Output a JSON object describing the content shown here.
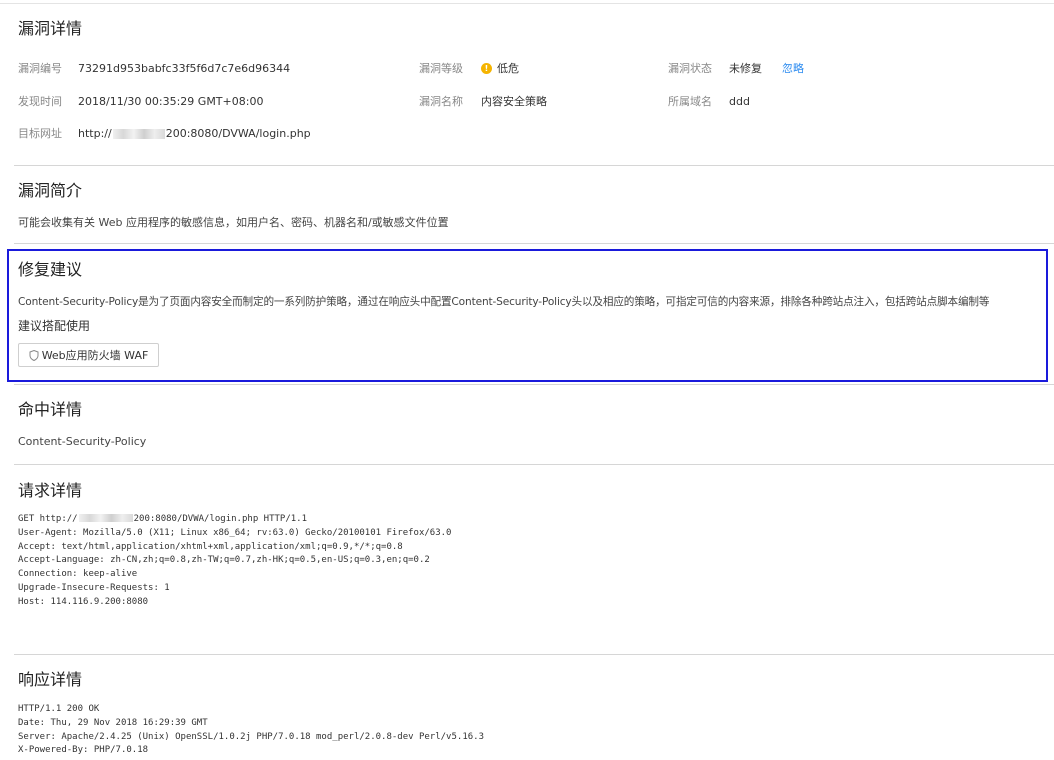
{
  "vuln_details": {
    "title": "漏洞详情",
    "id_label": "漏洞编号",
    "id_value": "73291d953babfc33f5f6d7c7e6d96344",
    "level_label": "漏洞等级",
    "level_value": "低危",
    "level_color": "#f5b400",
    "status_label": "漏洞状态",
    "status_value": "未修复",
    "ignore_link": "忽略",
    "found_time_label": "发现时间",
    "found_time_value": "2018/11/30 00:35:29 GMT+08:00",
    "name_label": "漏洞名称",
    "name_value": "内容安全策略",
    "domain_label": "所属域名",
    "domain_value": "ddd",
    "url_label": "目标网址",
    "url_prefix": "http://",
    "url_suffix": "200:8080/DVWA/login.php"
  },
  "summary": {
    "title": "漏洞简介",
    "text": "可能会收集有关 Web 应用程序的敏感信息，如用户名、密码、机器名和/或敏感文件位置"
  },
  "fix": {
    "title": "修复建议",
    "text": "Content-Security-Policy是为了页面内容安全而制定的一系列防护策略，通过在响应头中配置Content-Security-Policy头以及相应的策略，可指定可信的内容来源，排除各种跨站点注入，包括跨站点脚本编制等",
    "recommend_label": "建议搭配使用",
    "waf_button": "Web应用防火墙 WAF",
    "highlight_color": "#1a1adb"
  },
  "hit": {
    "title": "命中详情",
    "text": "Content-Security-Policy"
  },
  "request": {
    "title": "请求详情",
    "line1_prefix": "GET http://",
    "line1_suffix": "200:8080/DVWA/login.php HTTP/1.1",
    "lines": [
      "User-Agent: Mozilla/5.0 (X11; Linux x86_64; rv:63.0) Gecko/20100101 Firefox/63.0",
      "Accept: text/html,application/xhtml+xml,application/xml;q=0.9,*/*;q=0.8",
      "Accept-Language: zh-CN,zh;q=0.8,zh-TW;q=0.7,zh-HK;q=0.5,en-US;q=0.3,en;q=0.2",
      "Connection: keep-alive",
      "Upgrade-Insecure-Requests: 1",
      "Host: 114.116.9.200:8080"
    ]
  },
  "response": {
    "title": "响应详情",
    "lines": [
      "HTTP/1.1 200 OK",
      "Date: Thu, 29 Nov 2018 16:29:39 GMT",
      "Server: Apache/2.4.25 (Unix) OpenSSL/1.0.2j PHP/7.0.18 mod_perl/2.0.8-dev Perl/v5.16.3",
      "X-Powered-By: PHP/7.0.18"
    ]
  }
}
